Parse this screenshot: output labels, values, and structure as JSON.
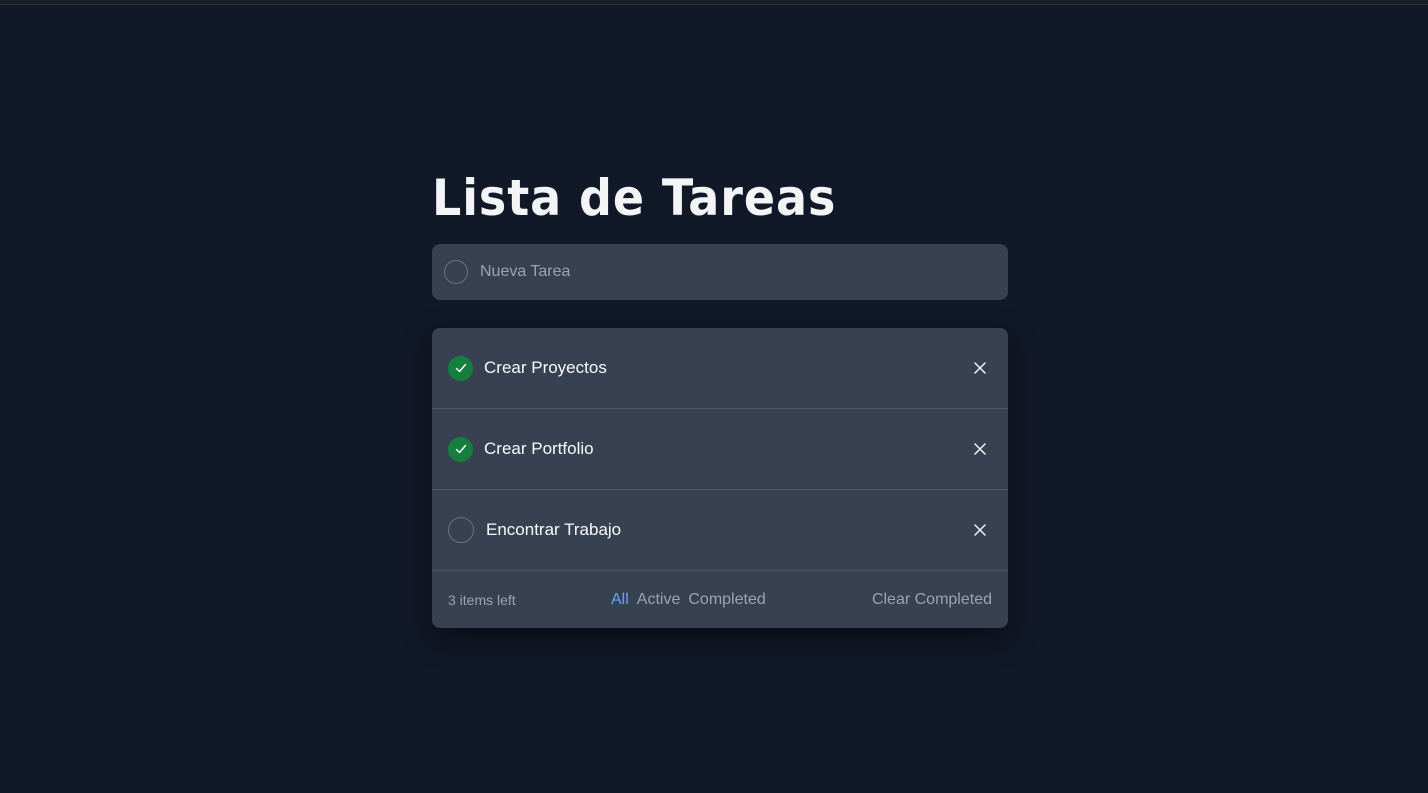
{
  "header": {
    "title": "Lista de Tareas"
  },
  "new_task": {
    "placeholder": "Nueva Tarea",
    "value": ""
  },
  "todos": [
    {
      "text": "Crear Proyectos",
      "completed": true
    },
    {
      "text": "Crear Portfolio",
      "completed": true
    },
    {
      "text": "Encontrar Trabajo",
      "completed": false
    }
  ],
  "footer": {
    "items_left": "3 items left",
    "filters": [
      "All",
      "Active",
      "Completed"
    ],
    "active_filter": "All",
    "clear_label": "Clear Completed"
  },
  "icons": {
    "check": "check-icon",
    "close": "close-icon",
    "empty_circle": "circle-icon"
  },
  "colors": {
    "background": "#111827",
    "panel": "#374151",
    "completed_check": "#15803d",
    "active_filter": "#60a5fa",
    "muted_text": "#9ca3af"
  }
}
